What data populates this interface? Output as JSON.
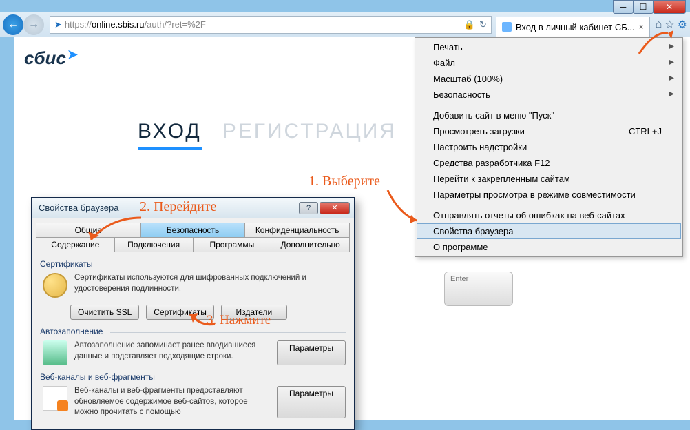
{
  "ann": {
    "step1": "1. Выберите",
    "step2": "2. Перейдите",
    "step3": "3. Нажмите"
  },
  "url": {
    "scheme": "https://",
    "host": "online.sbis.ru",
    "path": "/auth/?ret=%2F"
  },
  "tab": {
    "title": "Вход в личный кабинет СБ...",
    "close": "×"
  },
  "page": {
    "logo": "сбис",
    "login_tab": "ВХОД",
    "register_tab": "РЕГИСТРАЦИЯ",
    "enter_key": "Enter"
  },
  "menu": {
    "print": "Печать",
    "file": "Файл",
    "zoom": "Масштаб (100%)",
    "safety": "Безопасность",
    "add_start": "Добавить сайт в меню \"Пуск\"",
    "downloads": "Просмотреть загрузки",
    "downloads_key": "CTRL+J",
    "addons": "Настроить надстройки",
    "devtools": "Средства разработчика F12",
    "pinned": "Перейти к закрепленным сайтам",
    "compat": "Параметры просмотра в режиме совместимости",
    "errors": "Отправлять отчеты об ошибках на веб-сайтах",
    "options": "Свойства браузера",
    "about": "О программе"
  },
  "dlg": {
    "title": "Свойства браузера",
    "tabs_r1": {
      "general": "Общие",
      "security": "Безопасность",
      "privacy": "Конфиденциальность"
    },
    "tabs_r2": {
      "content": "Содержание",
      "connections": "Подключения",
      "programs": "Программы",
      "advanced": "Дополнительно"
    },
    "certs": {
      "title": "Сертификаты",
      "desc": "Сертификаты используются для шифрованных подключений и удостоверения подлинности.",
      "btn_clear": "Очистить SSL",
      "btn_certs": "Сертификаты",
      "btn_pub": "Издатели"
    },
    "autofill": {
      "title": "Автозаполнение",
      "desc": "Автозаполнение запоминает ранее вводившиеся данные и подставляет подходящие строки.",
      "btn": "Параметры"
    },
    "feeds": {
      "title": "Веб-каналы и веб-фрагменты",
      "desc": "Веб-каналы и веб-фрагменты предоставляют обновляемое содержимое веб-сайтов, которое можно прочитать с помощью",
      "btn": "Параметры"
    }
  }
}
